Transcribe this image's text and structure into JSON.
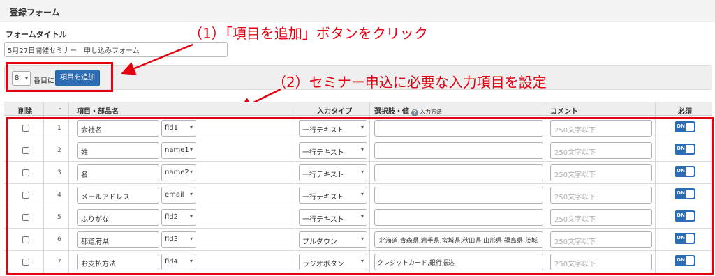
{
  "panel": {
    "title": "登録フォーム"
  },
  "form_title": {
    "label": "フォームタイトル",
    "value": "5月27日開催セミナー　申し込みフォーム"
  },
  "toolbar": {
    "position_value": "8",
    "position_suffix": "番目に",
    "add_button_label": "項目を追加"
  },
  "annotations": {
    "step1": "（1）「項目を追加」ボタンをクリック",
    "step2": "（2）セミナー申込に必要な入力項目を設定"
  },
  "table": {
    "headers": {
      "delete": "削除",
      "order": "-",
      "item_name": "項目・部品名",
      "input_type": "入力タイプ",
      "options": "選択肢・値",
      "options_help_icon": "?",
      "options_help": "入力方法",
      "comment": "コメント",
      "required": "必須"
    },
    "comment_placeholder": "250文字以下",
    "toggle_label": "ON",
    "rows": [
      {
        "num": "1",
        "name": "会社名",
        "field": "fld1",
        "type": "一行テキスト",
        "options": ""
      },
      {
        "num": "2",
        "name": "姓",
        "field": "name1",
        "type": "一行テキスト",
        "options": ""
      },
      {
        "num": "3",
        "name": "名",
        "field": "name2",
        "type": "一行テキスト",
        "options": ""
      },
      {
        "num": "4",
        "name": "メールアドレス",
        "field": "email",
        "type": "一行テキスト",
        "options": ""
      },
      {
        "num": "5",
        "name": "ふりがな",
        "field": "fld2",
        "type": "一行テキスト",
        "options": ""
      },
      {
        "num": "6",
        "name": "都道府県",
        "field": "fld3",
        "type": "プルダウン",
        "options": ",北海道,青森県,岩手県,宮城県,秋田県,山形県,福島県,茨城"
      },
      {
        "num": "7",
        "name": "お支払方法",
        "field": "fld4",
        "type": "ラジオボタン",
        "options": "クレジットカード,銀行振込"
      }
    ]
  },
  "colors": {
    "accent": "#2b6cb5",
    "annotation": "#e3000f"
  },
  "icons": {
    "dropdown": "chevron-down-icon",
    "help": "help-icon"
  }
}
